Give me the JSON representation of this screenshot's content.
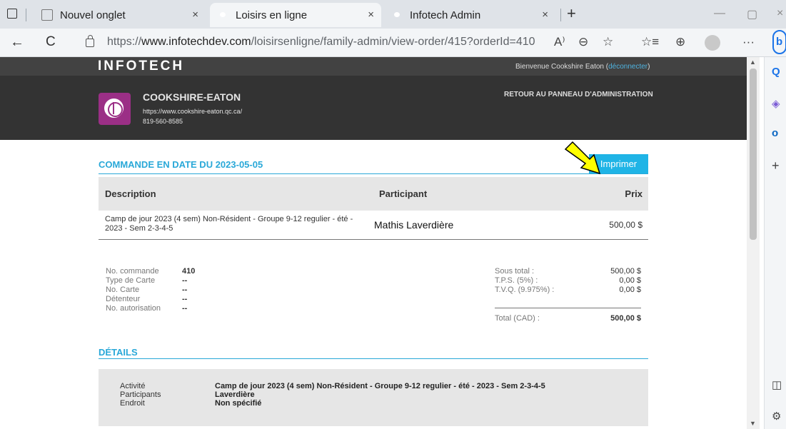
{
  "browser": {
    "tabs": [
      {
        "label": "Nouvel onglet"
      },
      {
        "label": "Loisirs en ligne"
      },
      {
        "label": "Infotech Admin"
      }
    ],
    "new_tab": "+",
    "url_prefix": "https://",
    "url_domain": "www.infotechdev.com",
    "url_path": "/loisirsenligne/family-admin/view-order/415?orderId=410",
    "icons": {
      "back": "←",
      "refresh": "C",
      "read_aloud": "A⁾",
      "zoom": "⊖",
      "favorite": "☆",
      "favorites_bar": "☆≡",
      "collections": "⊕",
      "more": "···",
      "close": "×",
      "minimize": "—",
      "maximize": "▢"
    },
    "sidebar_icons": [
      "Q",
      "◈",
      "o",
      "+",
      "◫",
      "⚙"
    ]
  },
  "site": {
    "logo": "INFOTECH",
    "welcome_text": "Bienvenue Cookshire Eaton (",
    "logout": "déconnecter",
    "welcome_end": ")",
    "org_name": "COOKSHIRE-EATON",
    "org_url": "https://www.cookshire-eaton.qc.ca/",
    "org_phone": "819-560-8585",
    "back_link": "RETOUR AU PANNEAU D'ADMINISTRATION"
  },
  "order": {
    "title": "COMMANDE EN DATE DU 2023-05-05",
    "print_label": "Imprimer",
    "columns": {
      "description": "Description",
      "participant": "Participant",
      "price": "Prix"
    },
    "items": [
      {
        "description": "Camp de jour 2023 (4 sem) Non-Résident - Groupe 9-12 regulier - été - 2023 - Sem 2-3-4-5",
        "participant": "Mathis Laverdière",
        "price": "500,00 $"
      }
    ],
    "info": [
      {
        "label": "No. commande",
        "value": "410"
      },
      {
        "label": "Type de Carte",
        "value": "--"
      },
      {
        "label": "No. Carte",
        "value": "--"
      },
      {
        "label": "Détenteur",
        "value": "--"
      },
      {
        "label": "No. autorisation",
        "value": "--"
      }
    ],
    "totals": [
      {
        "label": "Sous total :",
        "value": "500,00 $"
      },
      {
        "label": "T.P.S. (5%) :",
        "value": "0,00 $"
      },
      {
        "label": "T.V.Q. (9.975%) :",
        "value": "0,00 $"
      }
    ],
    "total": {
      "label": "Total (CAD) :",
      "value": "500,00 $"
    }
  },
  "details": {
    "title": "DÉTAILS",
    "rows": [
      {
        "label": "Activité",
        "value": "Camp de jour 2023 (4 sem) Non-Résident - Groupe 9-12 regulier - été - 2023 - Sem 2-3-4-5"
      },
      {
        "label": "Participants",
        "value": "Laverdière"
      },
      {
        "label": "Endroit",
        "value": "Non spécifié"
      }
    ]
  },
  "colors": {
    "accent": "#29a8d8",
    "button": "#1fb4e6",
    "header": "#333333",
    "org_logo": "#9b2f86",
    "arrow": "#ffff00"
  }
}
